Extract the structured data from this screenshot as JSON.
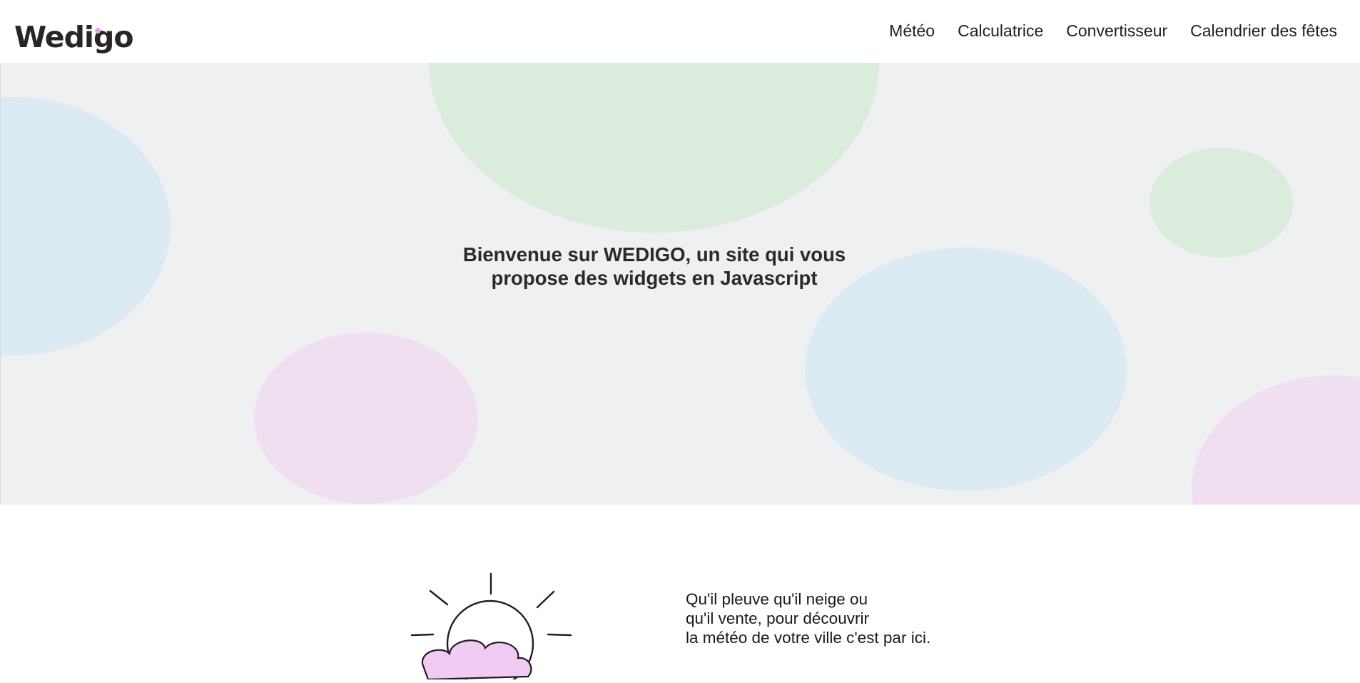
{
  "header": {
    "logo_text": "Wedigo",
    "nav": [
      {
        "label": "Météo"
      },
      {
        "label": "Calculatrice"
      },
      {
        "label": "Convertisseur"
      },
      {
        "label": "Calendrier des fêtes"
      }
    ]
  },
  "hero": {
    "title": "Bienvenue sur WEDIGO, un site qui vous\npropose des widgets en Javascript"
  },
  "feature_weather": {
    "icon": "sun-cloud-icon",
    "lines": [
      "Qu'il pleuve qu'il neige ou",
      "qu'il vente, pour découvrir",
      "la météo de votre ville c'est par ici."
    ]
  },
  "colors": {
    "hero_background": "#eff0f1",
    "blob_blue": "#dceaf3",
    "blob_green": "#dbebdc",
    "blob_pink": "#f0dff1",
    "logo_green": "#a8d8a8",
    "logo_pink": "#e7a1e7",
    "cloud_pink": "#f2cbf2"
  }
}
